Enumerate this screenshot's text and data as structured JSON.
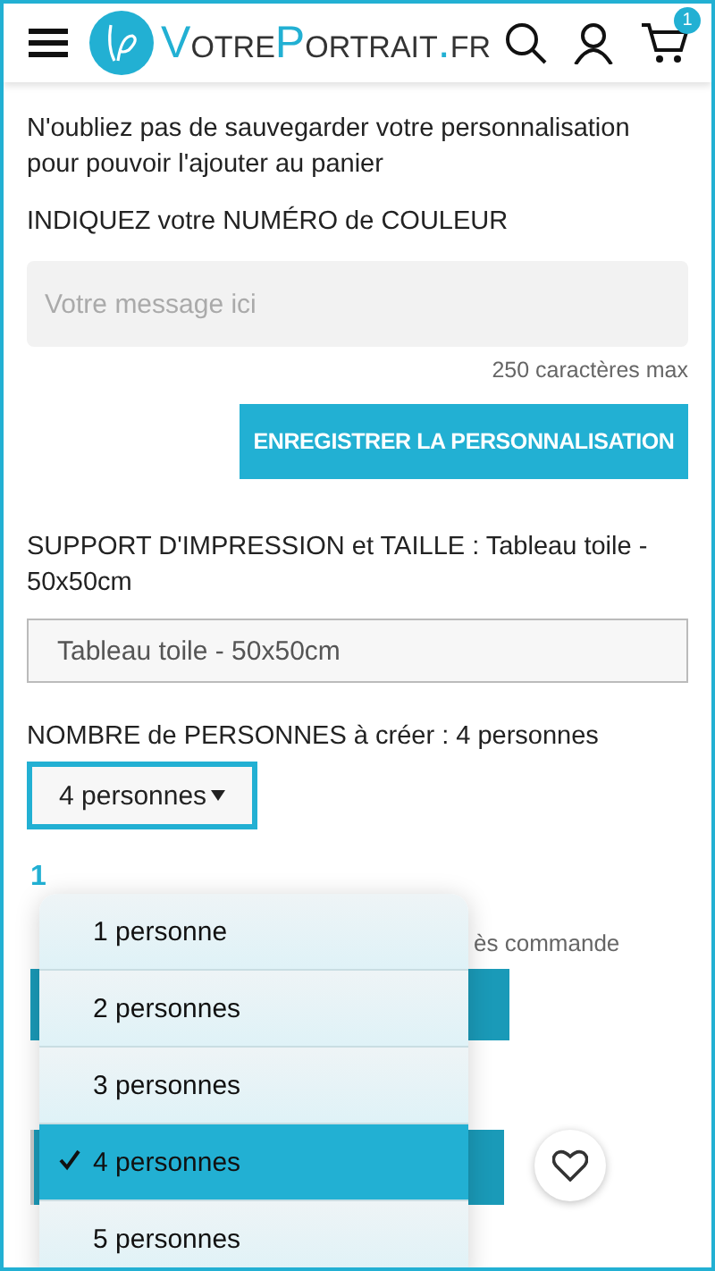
{
  "header": {
    "logo_parts": [
      {
        "text": "V",
        "accent": true
      },
      {
        "text": "OTRE",
        "accent": false
      },
      {
        "text": "P",
        "accent": true
      },
      {
        "text": "ORTRAIT",
        "accent": false
      },
      {
        "text": ".",
        "accent": true
      },
      {
        "text": "FR",
        "accent": false
      }
    ],
    "cart_count": "1"
  },
  "notice": "N'oubliez pas de sauvegarder votre personnalisation pour pouvoir l'ajouter au panier",
  "color_field": {
    "label": "INDIQUEZ votre NUMÉRO de COULEUR",
    "placeholder": "Votre message ici",
    "hint": "250 caractères max"
  },
  "save_button": "ENREGISTRER LA PERSONNALISATION",
  "support": {
    "label": "SUPPORT D'IMPRESSION et TAILLE : Tableau toile - 50x50cm",
    "value": "Tableau toile - 50x50cm"
  },
  "persons": {
    "label": "NOMBRE de PERSONNES à créer : 4 personnes",
    "value": "4 personnes",
    "expanded": true,
    "options": [
      {
        "label": "1 personne",
        "selected": false
      },
      {
        "label": "2 personnes",
        "selected": false
      },
      {
        "label": "3 personnes",
        "selected": false
      },
      {
        "label": "4 personnes",
        "selected": true
      },
      {
        "label": "5 personnes",
        "selected": false
      }
    ]
  },
  "covered": {
    "price_start": "1",
    "line_end": "ès commande"
  }
}
